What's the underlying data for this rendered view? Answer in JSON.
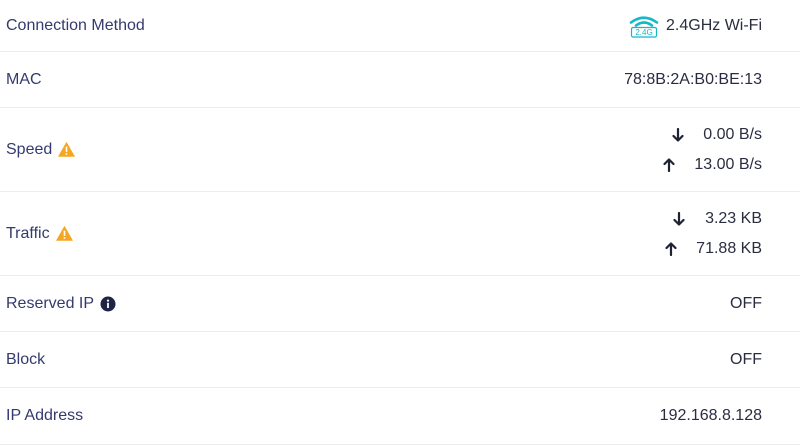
{
  "rows": [
    {
      "label": "Connection Method",
      "value": "2.4GHz Wi-Fi",
      "badge": "2.4G"
    },
    {
      "label": "MAC",
      "value": "78:8B:2A:B0:BE:13"
    },
    {
      "label": "Speed",
      "download": "0.00 B/s",
      "upload": "13.00 B/s"
    },
    {
      "label": "Traffic",
      "download": "3.23 KB",
      "upload": "71.88 KB"
    },
    {
      "label": "Reserved IP",
      "value": "OFF"
    },
    {
      "label": "Block",
      "value": "OFF"
    },
    {
      "label": "IP Address",
      "value": "192.168.8.128"
    }
  ],
  "icons": {
    "wifi": "wifi-2.4g-icon",
    "warning": "warning-icon",
    "info": "info-icon",
    "download": "arrow-down-icon",
    "upload": "arrow-up-icon"
  },
  "colors": {
    "accent": "#14b8c8",
    "warning": "#f5a623",
    "label": "#343a6e",
    "divider": "#ececf1"
  }
}
